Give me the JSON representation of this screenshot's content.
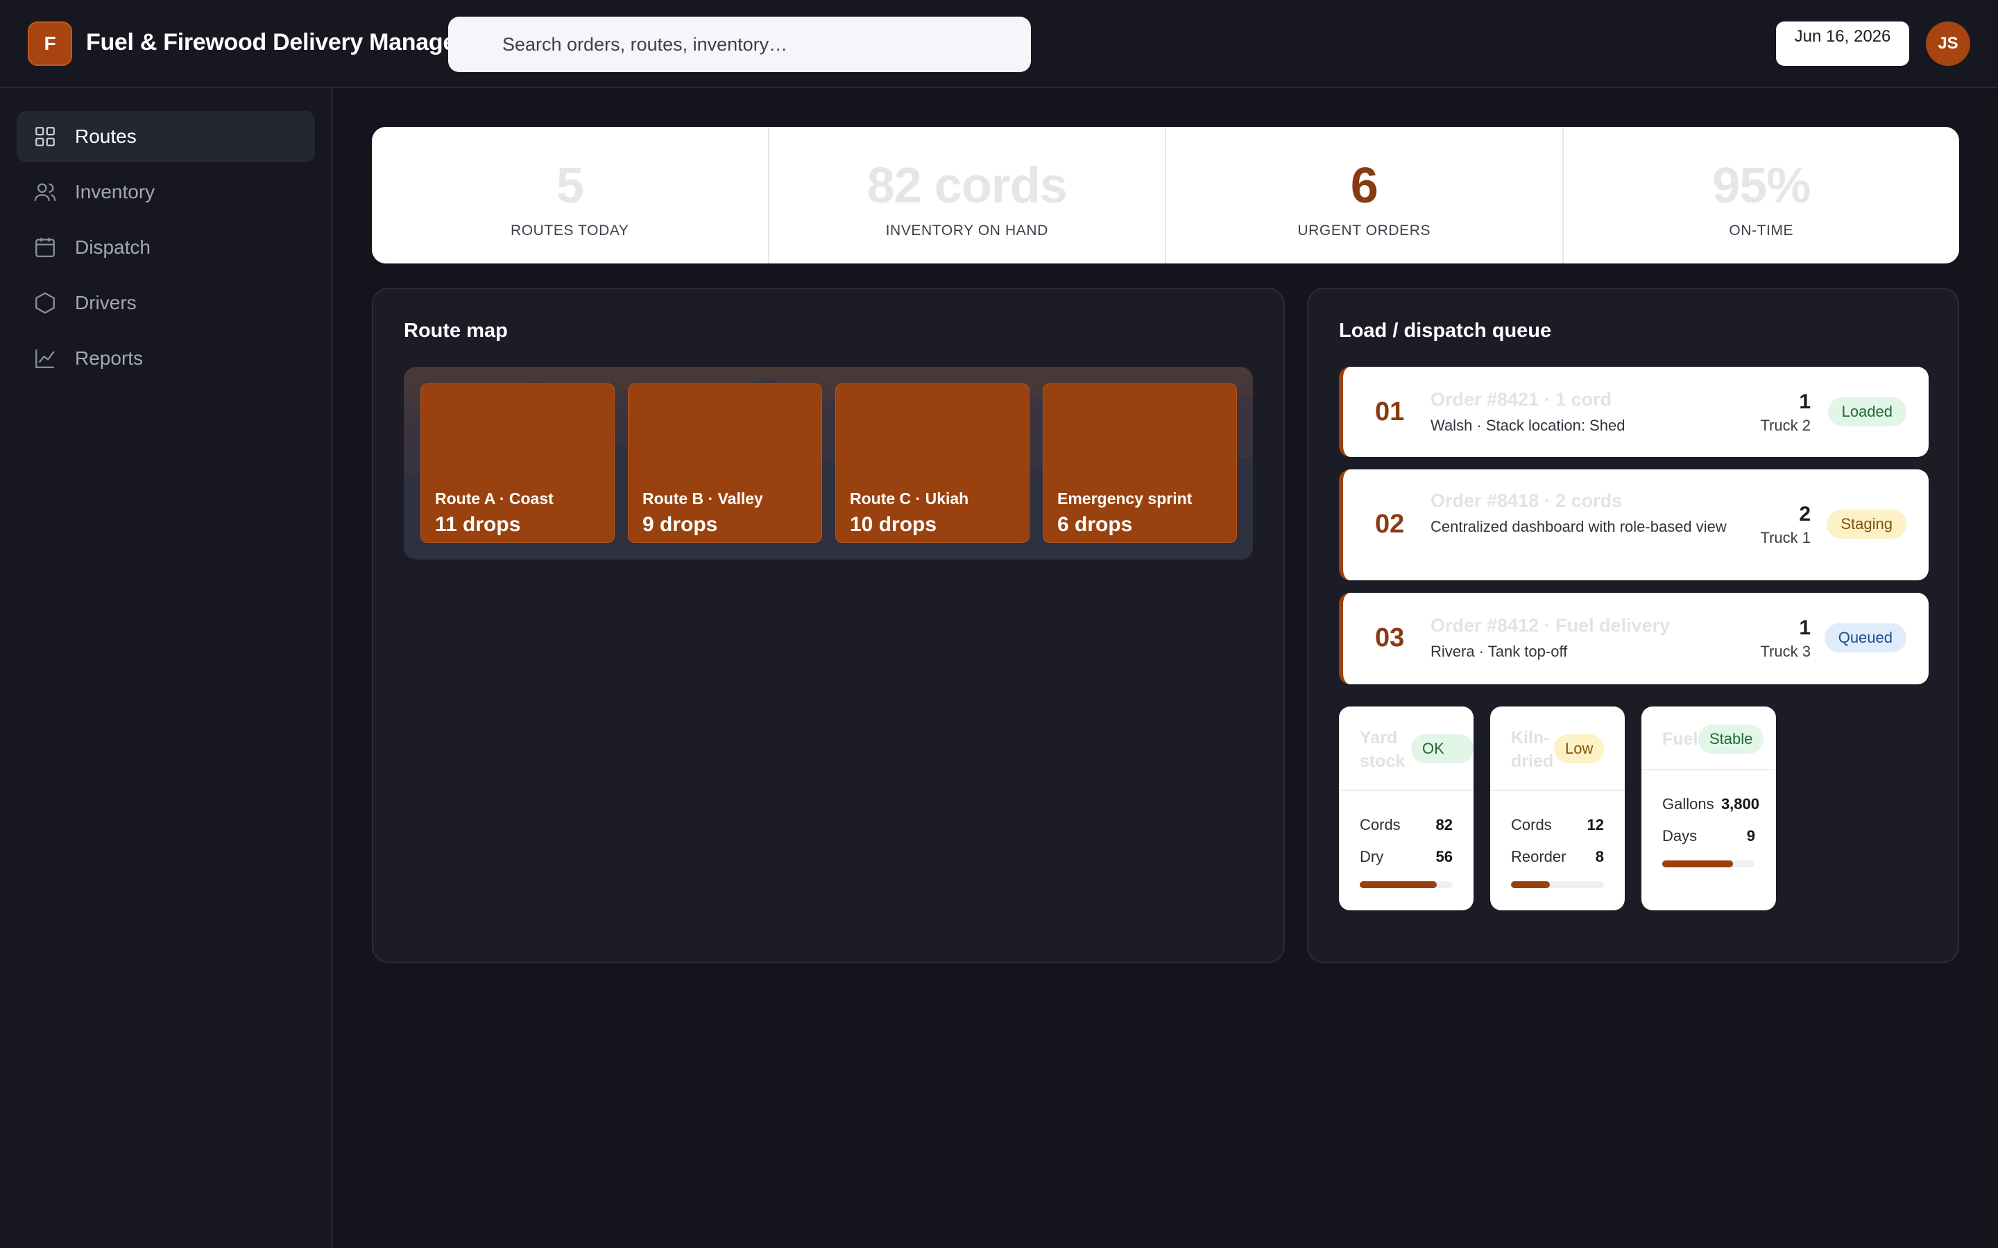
{
  "app": {
    "logo_letter": "F",
    "title": "Fuel & Firewood Delivery Manager"
  },
  "search": {
    "placeholder": "Search orders, routes, inventory…"
  },
  "header": {
    "date": "Jun 16, 2026",
    "avatar_initials": "JS"
  },
  "sidebar": {
    "items": [
      {
        "label": "Routes",
        "icon": "grid-icon",
        "active": true
      },
      {
        "label": "Inventory",
        "icon": "users-icon",
        "active": false
      },
      {
        "label": "Dispatch",
        "icon": "calendar-icon",
        "active": false
      },
      {
        "label": "Drivers",
        "icon": "hexagon-icon",
        "active": false
      },
      {
        "label": "Reports",
        "icon": "line-chart-icon",
        "active": false
      }
    ]
  },
  "kpis": [
    {
      "value": "5",
      "label": "ROUTES TODAY"
    },
    {
      "value": "82 cords",
      "label": "INVENTORY ON HAND"
    },
    {
      "value": "6",
      "label": "URGENT ORDERS"
    },
    {
      "value": "95%",
      "label": "ON-TIME"
    }
  ],
  "route_map": {
    "title": "Route map",
    "routes": [
      {
        "name": "Route A · Coast",
        "drops": "11 drops"
      },
      {
        "name": "Route B · Valley",
        "drops": "9 drops"
      },
      {
        "name": "Route C · Ukiah",
        "drops": "10 drops"
      },
      {
        "name": "Emergency sprint",
        "drops": "6 drops"
      }
    ]
  },
  "queue": {
    "title": "Load / dispatch queue",
    "items": [
      {
        "num": "01",
        "title": "Order #8421 · 1 cord",
        "sub": "Walsh · Stack location: Shed",
        "qty": "1",
        "truck": "Truck 2",
        "status": "Loaded",
        "status_color": "#1f6a35"
      },
      {
        "num": "02",
        "title": "Order #8418 · 2 cords",
        "sub": "Centralized dashboard with role-based view",
        "qty": "2",
        "truck": "Truck 1",
        "status": "Staging",
        "status_color": "#7d5408"
      },
      {
        "num": "03",
        "title": "Order #8412 · Fuel delivery",
        "sub": "Rivera · Tank top-off",
        "qty": "1",
        "truck": "Truck 3",
        "status": "Queued",
        "status_color": "#1f4c8a"
      }
    ]
  },
  "stock_cards": [
    {
      "name": "Yard stock",
      "status": "OK",
      "rows": [
        {
          "label": "Cords",
          "value": "82"
        },
        {
          "label": "Dry",
          "value": "56"
        }
      ],
      "level": 0.83
    },
    {
      "name": "Kiln-dried",
      "status": "Low",
      "rows": [
        {
          "label": "Cords",
          "value": "12"
        },
        {
          "label": "Reorder",
          "value": "8"
        }
      ],
      "level": 0.42
    },
    {
      "name": "Fuel",
      "status": "Stable",
      "rows": [
        {
          "label": "Gallons",
          "value": "3,800"
        },
        {
          "label": "Days",
          "value": "9"
        }
      ],
      "level": 0.76
    }
  ],
  "colors": {
    "accent": "#a8440f",
    "background": "#13141c",
    "panel": "#1b1c26"
  }
}
